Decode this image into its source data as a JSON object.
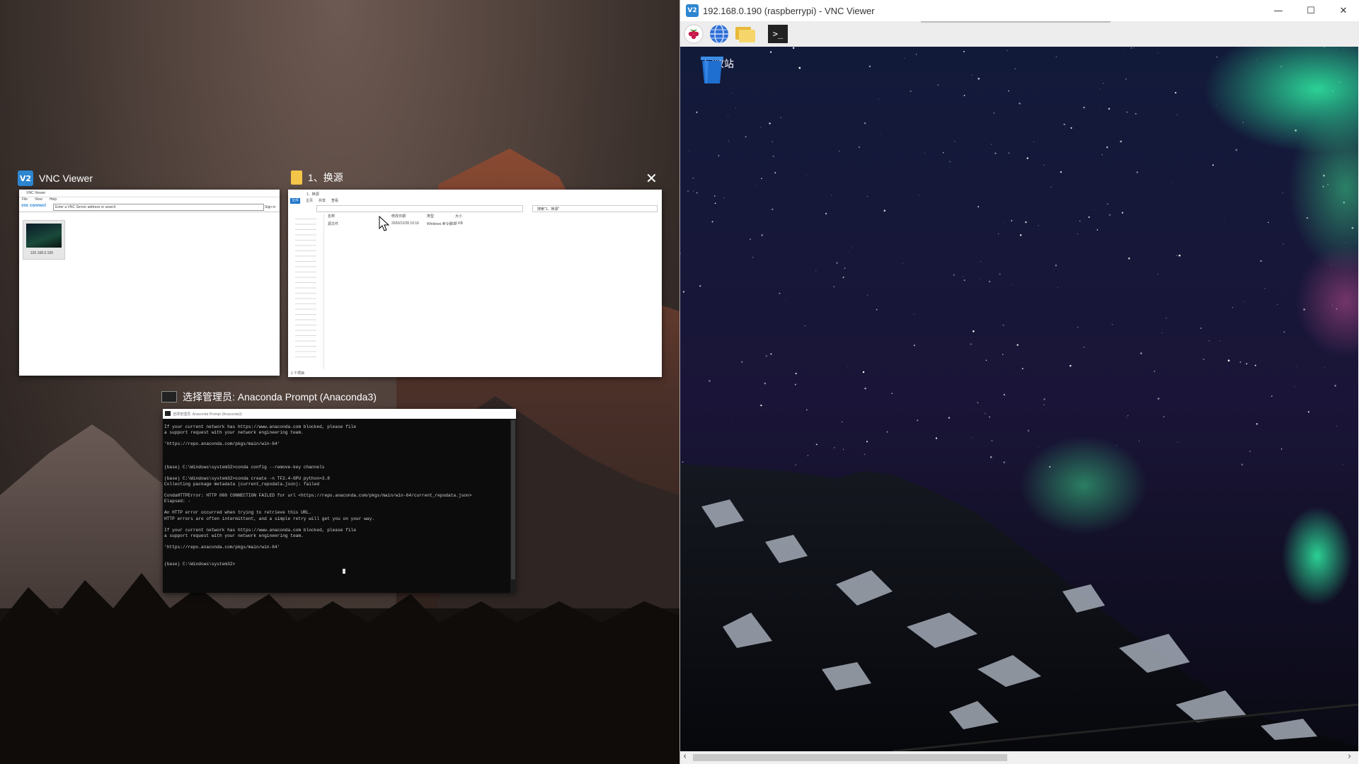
{
  "snap": {
    "vnc_viewer": {
      "title": "VNC Viewer",
      "brand": "vnc connect",
      "menu": [
        "File",
        "View",
        "Help"
      ],
      "search_placeholder": "Enter a VNC Server address or search",
      "sign_in": "Sign in",
      "connection_label": "192.168.0.190"
    },
    "explorer": {
      "title": "1、换源",
      "tabs": [
        "文件",
        "主页",
        "共享",
        "查看"
      ],
      "search_placeholder": "搜索\"1、换源\"",
      "column_headers": [
        "名称",
        "修改日期",
        "类型",
        "大小"
      ],
      "file_row": [
        "源文件",
        "2020/12/28 10:16",
        "Windows 命令脚本",
        "1 KB"
      ],
      "status": "1 个项目"
    },
    "anaconda": {
      "title": "选择管理员: Anaconda Prompt (Anaconda3)",
      "inner_title": "选择管理员: Anaconda Prompt (Anaconda3)",
      "lines": [
        "If your current network has https://www.anaconda.com blocked, please file",
        "a support request with your network engineering team.",
        "",
        "'https://repo.anaconda.com/pkgs/main/win-64'",
        "",
        "",
        "",
        "(base) C:\\Windows\\system32>conda config --remove-key channels",
        "",
        "(base) C:\\Windows\\system32>conda create -n TF2.4-GPU python=3.8",
        "Collecting package metadata (current_repodata.json): failed",
        "",
        "CondaHTTPError: HTTP 000 CONNECTION FAILED for url <https://repo.anaconda.com/pkgs/main/win-64/current_repodata.json>",
        "Elapsed: -",
        "",
        "An HTTP error occurred when trying to retrieve this URL.",
        "HTTP errors are often intermittent, and a simple retry will get you on your way.",
        "",
        "If your current network has https://www.anaconda.com blocked, please file",
        "a support request with your network engineering team.",
        "",
        "'https://repo.anaconda.com/pkgs/main/win-64'",
        "",
        "",
        "(base) C:\\Windows\\system32>"
      ]
    }
  },
  "vnc_window": {
    "title": "192.168.0.190 (raspberrypi) - VNC Viewer",
    "controls": {
      "minimize": "—",
      "maximize": "☐",
      "close": "✕"
    },
    "taskbar_icons": [
      "raspberry-menu-icon",
      "web-browser-icon",
      "file-manager-icon",
      "terminal-icon"
    ],
    "terminal_glyph": ">_",
    "desktop_items": [
      {
        "label": "回收站",
        "icon": "trash-icon"
      }
    ],
    "scroll_left": "‹",
    "scroll_right": "›"
  },
  "colors": {
    "vnc_blue": "#2c86d1",
    "folder_yellow": "#f3c548",
    "terminal_bg": "#0c0c0c",
    "aurora_green": "#2ee6a0"
  }
}
